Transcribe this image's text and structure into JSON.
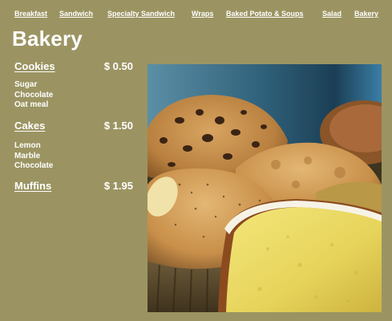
{
  "nav": {
    "links": [
      {
        "label": "Breakfast"
      },
      {
        "label": "Sandwich"
      },
      {
        "label": "Specialty Sandwich"
      },
      {
        "label": "Wraps"
      },
      {
        "label": "Baked Potato & Soups"
      },
      {
        "label": "Salad"
      },
      {
        "label": "Bakery"
      }
    ]
  },
  "page": {
    "title": "Bakery"
  },
  "menu": {
    "categories": [
      {
        "name": "Cookies",
        "price": "$ 0.50",
        "items": [
          "Sugar",
          "Chocolate",
          "Oat meal"
        ]
      },
      {
        "name": "Cakes",
        "price": "$ 1.50",
        "items": [
          "Lemon",
          "Marble",
          "Chocolate"
        ]
      },
      {
        "name": "Muffins",
        "price": "$ 1.95",
        "items": []
      }
    ]
  },
  "colors": {
    "background": "#9b9462",
    "text": "#ffffff"
  },
  "image": {
    "subject": "muffins-and-pound-cake-photo"
  }
}
